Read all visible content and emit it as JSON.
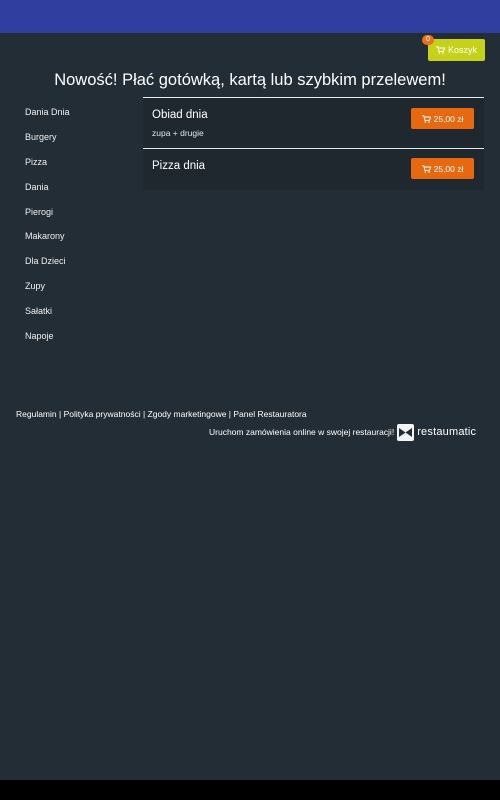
{
  "header": {
    "cart_label": "Koszyk",
    "cart_count": "0",
    "cart_color": "#c6d11a",
    "badge_color": "#e8711b"
  },
  "headline": "Nowość! Płać gotówką, kartą lub szybkim przelewem!",
  "sidebar": {
    "items": [
      {
        "label": "Dania Dnia"
      },
      {
        "label": "Burgery"
      },
      {
        "label": "Pizza"
      },
      {
        "label": "Dania"
      },
      {
        "label": "Pierogi"
      },
      {
        "label": "Makarony"
      },
      {
        "label": "Dla Dzieci"
      },
      {
        "label": "Zupy"
      },
      {
        "label": "Sałatki"
      },
      {
        "label": "Napoje"
      }
    ]
  },
  "menu": {
    "items": [
      {
        "title": "Obiad dnia",
        "description": "zupa + drugie",
        "price": "25,00 zł"
      },
      {
        "title": "Pizza dnia",
        "description": "",
        "price": "25,00 zł"
      }
    ],
    "price_button_color": "#e8680f"
  },
  "footer": {
    "links": [
      "Regulamin",
      "Polityka prywatności",
      "Zgody marketingowe",
      "Panel Restauratora"
    ],
    "promo_text": "Uruchom zamówienia online w swojej restauracji!",
    "brand_name": "restaumatic"
  },
  "icons": {
    "cart": "shopping-cart-icon",
    "logo": "bowtie-logo-icon"
  }
}
